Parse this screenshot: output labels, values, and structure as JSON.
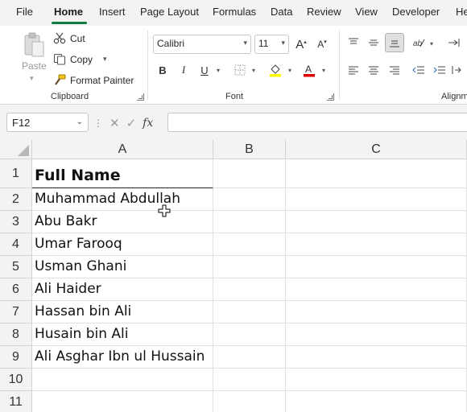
{
  "menu": {
    "tabs": [
      "File",
      "Home",
      "Insert",
      "Page Layout",
      "Formulas",
      "Data",
      "Review",
      "View",
      "Developer",
      "He"
    ],
    "active": "Home"
  },
  "ribbon": {
    "clipboard": {
      "paste_label": "Paste",
      "cut_label": "Cut",
      "copy_label": "Copy",
      "format_painter_label": "Format Painter",
      "group_label": "Clipboard"
    },
    "font": {
      "font_name": "Calibri",
      "font_size": "11",
      "group_label": "Font",
      "bold": "B",
      "italic": "I",
      "underline": "U",
      "fill_color": "#ffff00",
      "font_color": "#e00000"
    },
    "alignment": {
      "group_label": "Alignm"
    }
  },
  "formula_bar": {
    "name_box": "F12",
    "fx_label": "fx",
    "formula": ""
  },
  "sheet": {
    "columns": [
      "A",
      "B",
      "C"
    ],
    "rows": [
      "1",
      "2",
      "3",
      "4",
      "5",
      "6",
      "7",
      "8",
      "9",
      "10",
      "11"
    ],
    "cells_a": [
      "Full Name",
      "Muhammad Abdullah",
      "Abu Bakr",
      "Umar Farooq",
      "Usman Ghani",
      "Ali Haider",
      "Hassan bin Ali",
      "Husain bin Ali",
      "Ali Asghar Ibn ul Hussain",
      "",
      ""
    ]
  },
  "colors": {
    "accent": "#107c41",
    "chrome": "#f3f3f3"
  }
}
